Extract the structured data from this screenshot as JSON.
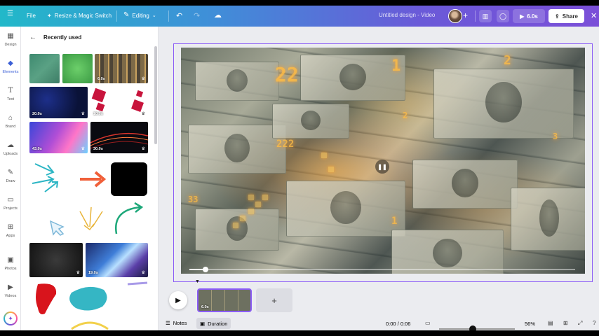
{
  "topbar": {
    "file": "File",
    "resize": "Resize & Magic Switch",
    "editing": "Editing",
    "doc_title": "Untitled design - Video",
    "play_duration": "6.0s",
    "share": "Share"
  },
  "rail": {
    "items": [
      {
        "label": "Design",
        "icon": "design-icon"
      },
      {
        "label": "Elements",
        "icon": "elements-icon"
      },
      {
        "label": "Text",
        "icon": "text-icon"
      },
      {
        "label": "Brand",
        "icon": "brand-icon"
      },
      {
        "label": "Uploads",
        "icon": "uploads-icon"
      },
      {
        "label": "Draw",
        "icon": "draw-icon"
      },
      {
        "label": "Projects",
        "icon": "projects-icon"
      },
      {
        "label": "Apps",
        "icon": "apps-icon"
      },
      {
        "label": "Photos",
        "icon": "photos-icon"
      },
      {
        "label": "Videos",
        "icon": "videos-icon"
      }
    ]
  },
  "panel": {
    "title": "Recently used",
    "durations": {
      "city": "6.0s",
      "stars": "20.0s",
      "diamonds": "10.0s",
      "gradient": "43.0s",
      "lights": "30.0s",
      "photo": "19.0s"
    }
  },
  "timeline": {
    "clip_duration": "6.0s"
  },
  "footer": {
    "notes": "Notes",
    "duration": "Duration",
    "time": "0:00 / 0:06",
    "zoom": "56%"
  },
  "colors": {
    "accent": "#8b5cf6",
    "gradient_start": "#22b8c9",
    "gradient_end": "#7b4fd8",
    "arrow_teal": "#2bb5c4",
    "arrow_orange": "#f0603a",
    "arrow_green": "#1ea87a"
  }
}
